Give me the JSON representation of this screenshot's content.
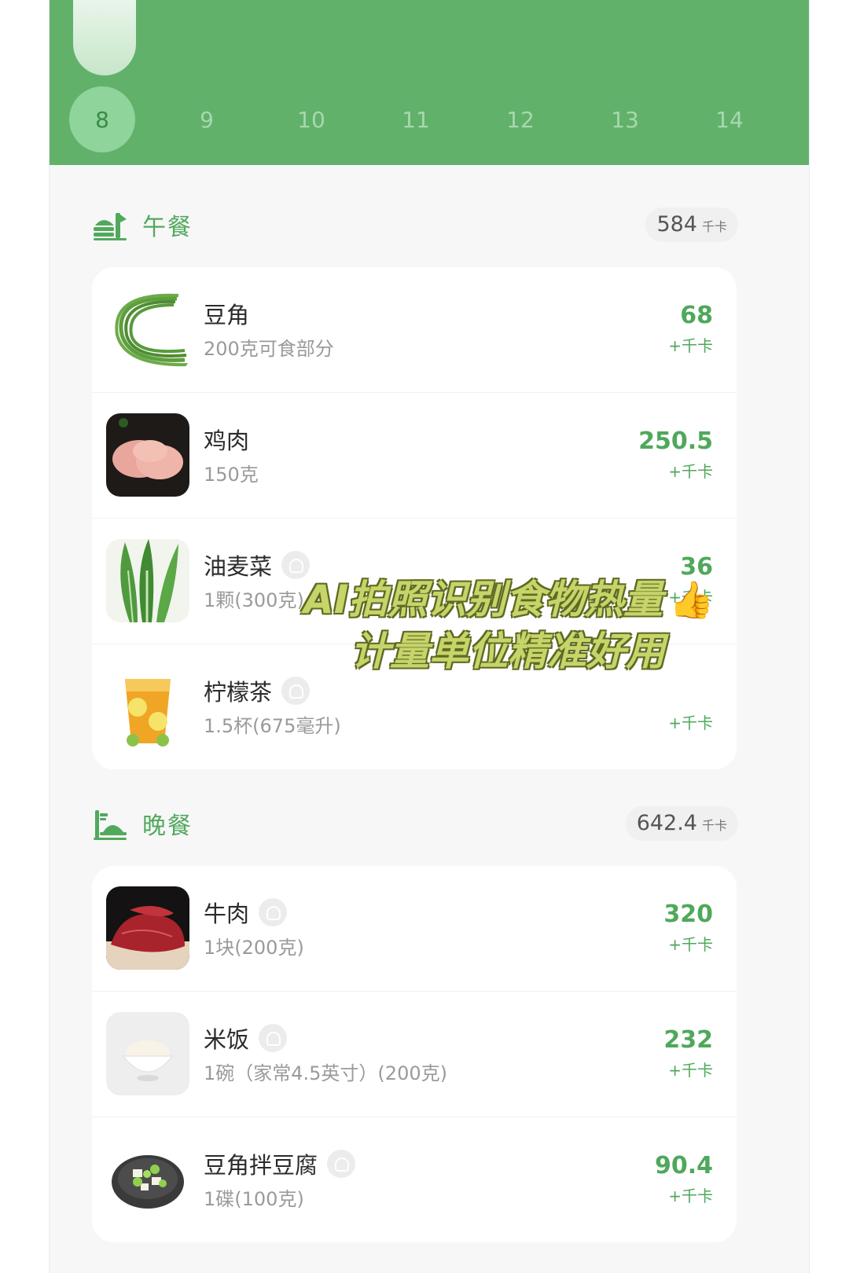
{
  "calendar": {
    "days": [
      "8",
      "9",
      "10",
      "11",
      "12",
      "13",
      "14"
    ],
    "selected_day": "8"
  },
  "lunch": {
    "title": "午餐",
    "total": "584",
    "total_unit": "千卡",
    "items": [
      {
        "name": "豆角",
        "amount": "200克可食部分",
        "kcal": "68",
        "unit": "+千卡",
        "icon": "long-beans-photo",
        "badge": false
      },
      {
        "name": "鸡肉",
        "amount": "150克",
        "kcal": "250.5",
        "unit": "+千卡",
        "icon": "chicken-breast-photo",
        "badge": false
      },
      {
        "name": "油麦菜",
        "amount": "1颗(300克)",
        "kcal": "36",
        "unit": "+千卡",
        "icon": "lettuce-photo",
        "badge": true
      },
      {
        "name": "柠檬茶",
        "amount": "1.5杯(675毫升)",
        "kcal": "",
        "unit": "+千卡",
        "icon": "lemon-tea-photo",
        "badge": true
      }
    ]
  },
  "dinner": {
    "title": "晚餐",
    "total": "642.4",
    "total_unit": "千卡",
    "items": [
      {
        "name": "牛肉",
        "amount": "1块(200克)",
        "kcal": "320",
        "unit": "+千卡",
        "icon": "beef-photo",
        "badge": true
      },
      {
        "name": "米饭",
        "amount": "1碗（家常4.5英寸）(200克)",
        "kcal": "232",
        "unit": "+千卡",
        "icon": "rice-bowl-photo",
        "badge": true
      },
      {
        "name": "豆角拌豆腐",
        "amount": "1碟(100克)",
        "kcal": "90.4",
        "unit": "+千卡",
        "icon": "beans-tofu-photo",
        "badge": true
      }
    ]
  },
  "overlay": {
    "line1": "AI拍照识别食物热量",
    "line2": "计量单位精准好用",
    "emoji": "👍"
  },
  "colors": {
    "brand_green": "#61b16b",
    "kcal_green": "#4fa85b",
    "overlay_text": "#c7d46a"
  }
}
